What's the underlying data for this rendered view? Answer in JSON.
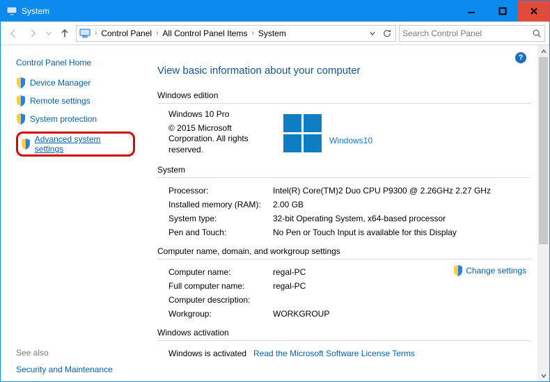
{
  "window": {
    "title": "System"
  },
  "nav": {
    "breadcrumbs": [
      "Control Panel",
      "All Control Panel Items",
      "System"
    ],
    "search_placeholder": "Search Control Panel"
  },
  "sidebar": {
    "home": "Control Panel Home",
    "items": [
      {
        "label": "Device Manager",
        "highlighted": false
      },
      {
        "label": "Remote settings",
        "highlighted": false
      },
      {
        "label": "System protection",
        "highlighted": false
      },
      {
        "label": "Advanced system settings",
        "highlighted": true
      }
    ],
    "see_also_header": "See also",
    "see_also": [
      "Security and Maintenance"
    ]
  },
  "page": {
    "title": "View basic information about your computer",
    "edition_header": "Windows edition",
    "edition_name": "Windows 10 Pro",
    "copyright": "© 2015 Microsoft Corporation. All rights reserved.",
    "logo_text": "Windows 10",
    "system_header": "System",
    "system": {
      "processor_k": "Processor:",
      "processor_v": "Intel(R) Core(TM)2 Duo CPU     P9300  @ 2.26GHz   2.27 GHz",
      "ram_k": "Installed memory (RAM):",
      "ram_v": "2.00 GB",
      "type_k": "System type:",
      "type_v": "32-bit Operating System, x64-based processor",
      "pen_k": "Pen and Touch:",
      "pen_v": "No Pen or Touch Input is available for this Display"
    },
    "name_header": "Computer name, domain, and workgroup settings",
    "change_settings": "Change settings",
    "name": {
      "comp_k": "Computer name:",
      "comp_v": "regal-PC",
      "full_k": "Full computer name:",
      "full_v": "regal-PC",
      "desc_k": "Computer description:",
      "desc_v": "",
      "wg_k": "Workgroup:",
      "wg_v": "WORKGROUP"
    },
    "activation_header": "Windows activation",
    "activation_status": "Windows is activated",
    "activation_link": "Read the Microsoft Software License Terms"
  }
}
